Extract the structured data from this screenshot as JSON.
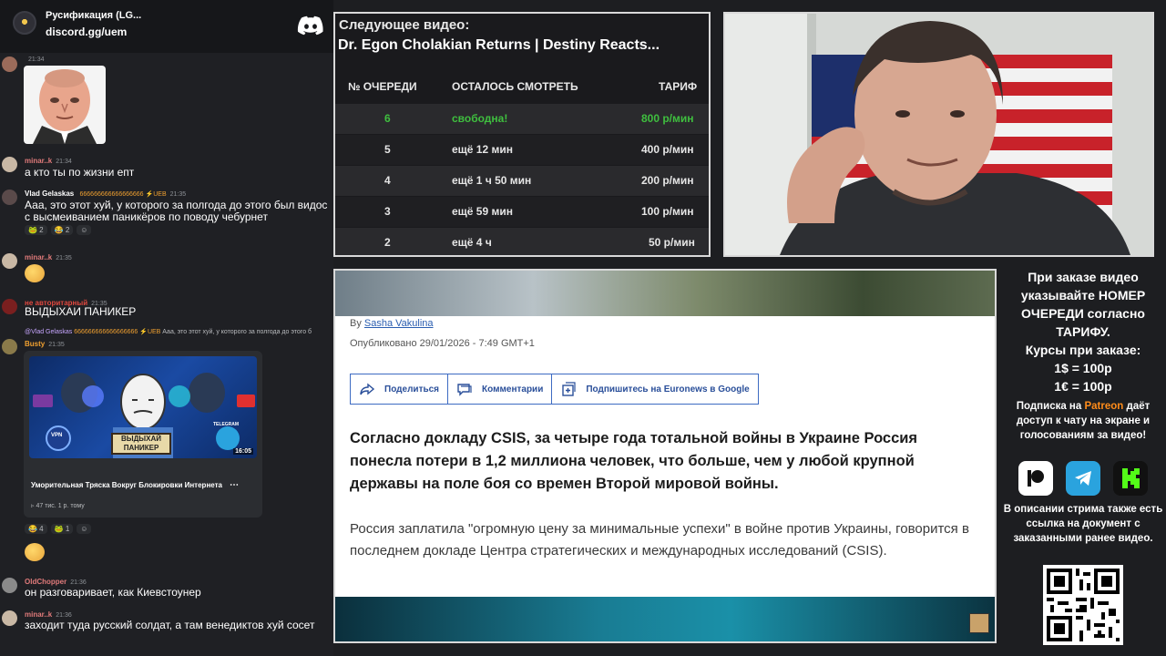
{
  "chat": {
    "server_name": "Русификация (LG...",
    "server_invite": "discord.gg/uem",
    "messages": [
      {
        "user": "minar..k",
        "time": "21:34",
        "text": "а кто ты по жизни епт",
        "color": "#e07a7a"
      },
      {
        "user": "Vlad Gelaskas",
        "badges": "666666666666666666 ⚡UEB",
        "time": "21:35",
        "text": "Ааа, это этот хуй, у которого за полгода до этого был видос с высмеиванием паникёров по поводу чебурнет",
        "reactions": [
          "🐸 2",
          "😂 2",
          "☺"
        ],
        "color": "#ffffff"
      },
      {
        "user": "minar..k",
        "time": "21:35",
        "color": "#e07a7a"
      },
      {
        "user": "не авторитарный",
        "time": "21:35",
        "text": "ВЫДЫХАИ ПАНИКЕР",
        "color": "#e0483f"
      },
      {
        "reply_user": "@Vlad Gelaskas",
        "reply_badges": "666666666666666666 ⚡UEB",
        "reply_text": "Ааа, это этот хуй, у которого за полгода до этого б",
        "user": "Busty",
        "time": "21:35",
        "reactions": [
          "😂 4",
          "🐸 1",
          "☺"
        ],
        "color": "#f0a030"
      },
      {
        "user": "OldChopper",
        "time": "21:36",
        "text": "он разговаривает, как Киевстоунер",
        "color": "#e07a7a"
      },
      {
        "user": "minar..k",
        "time": "21:36",
        "text": "заходит туда русский солдат, а там венедиктов хуй сосет",
        "color": "#e07a7a"
      }
    ],
    "video": {
      "title": "Уморительная Тряска Вокруг Блокировки Интернета",
      "stats": "▹ 47 тис.  1 р. тому",
      "duration": "16:05",
      "sign": "ВЫДЫХАЙ ПАНИКЕР",
      "menu": "⋯",
      "vpn_label": "VPN",
      "telegram_label": "TELEGRAM"
    }
  },
  "queue": {
    "label": "Следующее видео:",
    "title": "Dr. Egon Cholakian Returns | Destiny Reacts...",
    "headers": [
      "№ ОЧЕРЕДИ",
      "ОСТАЛОСЬ СМОТРЕТЬ",
      "ТАРИФ"
    ],
    "rows": [
      {
        "n": "6",
        "left": "свободна!",
        "rate": "800 р/мин",
        "free": true
      },
      {
        "n": "5",
        "left": "ещё 12 мин",
        "rate": "400 р/мин"
      },
      {
        "n": "4",
        "left": "ещё 1 ч 50 мин",
        "rate": "200 р/мин"
      },
      {
        "n": "3",
        "left": "ещё 59 мин",
        "rate": "100 р/мин"
      },
      {
        "n": "2",
        "left": "ещё 4 ч",
        "rate": "50 р/мин"
      }
    ],
    "free_color": "#3fbf3f"
  },
  "article": {
    "by": "By",
    "author": "Sasha Vakulina",
    "date": "Опубликовано 29/01/2026 - 7:49 GMT+1",
    "actions": [
      "Поделиться",
      "Комментарии",
      "Подпишитесь на Euronews в Google"
    ],
    "lead": "Согласно докладу CSIS, за четыре года тотальной войны в Украине Россия понесла потери в 1,2 миллиона человек, что больше, чем у любой крупной державы на поле боя со времен Второй мировой войны.",
    "body": "Россия заплатила \"огромную цену за минимальные успехи\" в войне против Украины, говорится в последнем докладе Центра стратегических и международных исследований (CSIS).",
    "accent": "#2a4f9a"
  },
  "info": {
    "order": "При заказе видео указывайте НОМЕР ОЧЕРЕДИ согласно ТАРИФУ.",
    "rates_title": "Курсы при заказе:",
    "usd": "1$ = 100р",
    "eur": "1€ = 100р",
    "sub_pre": "Подписка на",
    "sub_patreon": "Patreon",
    "sub_post": "даёт доступ к чату на экране и голосованиям за видео!",
    "desc": "В описании стрима также есть ссылка на документ с заказанными ранее видео.",
    "socials": [
      "patreon-icon",
      "telegram-icon",
      "kick-icon"
    ]
  }
}
